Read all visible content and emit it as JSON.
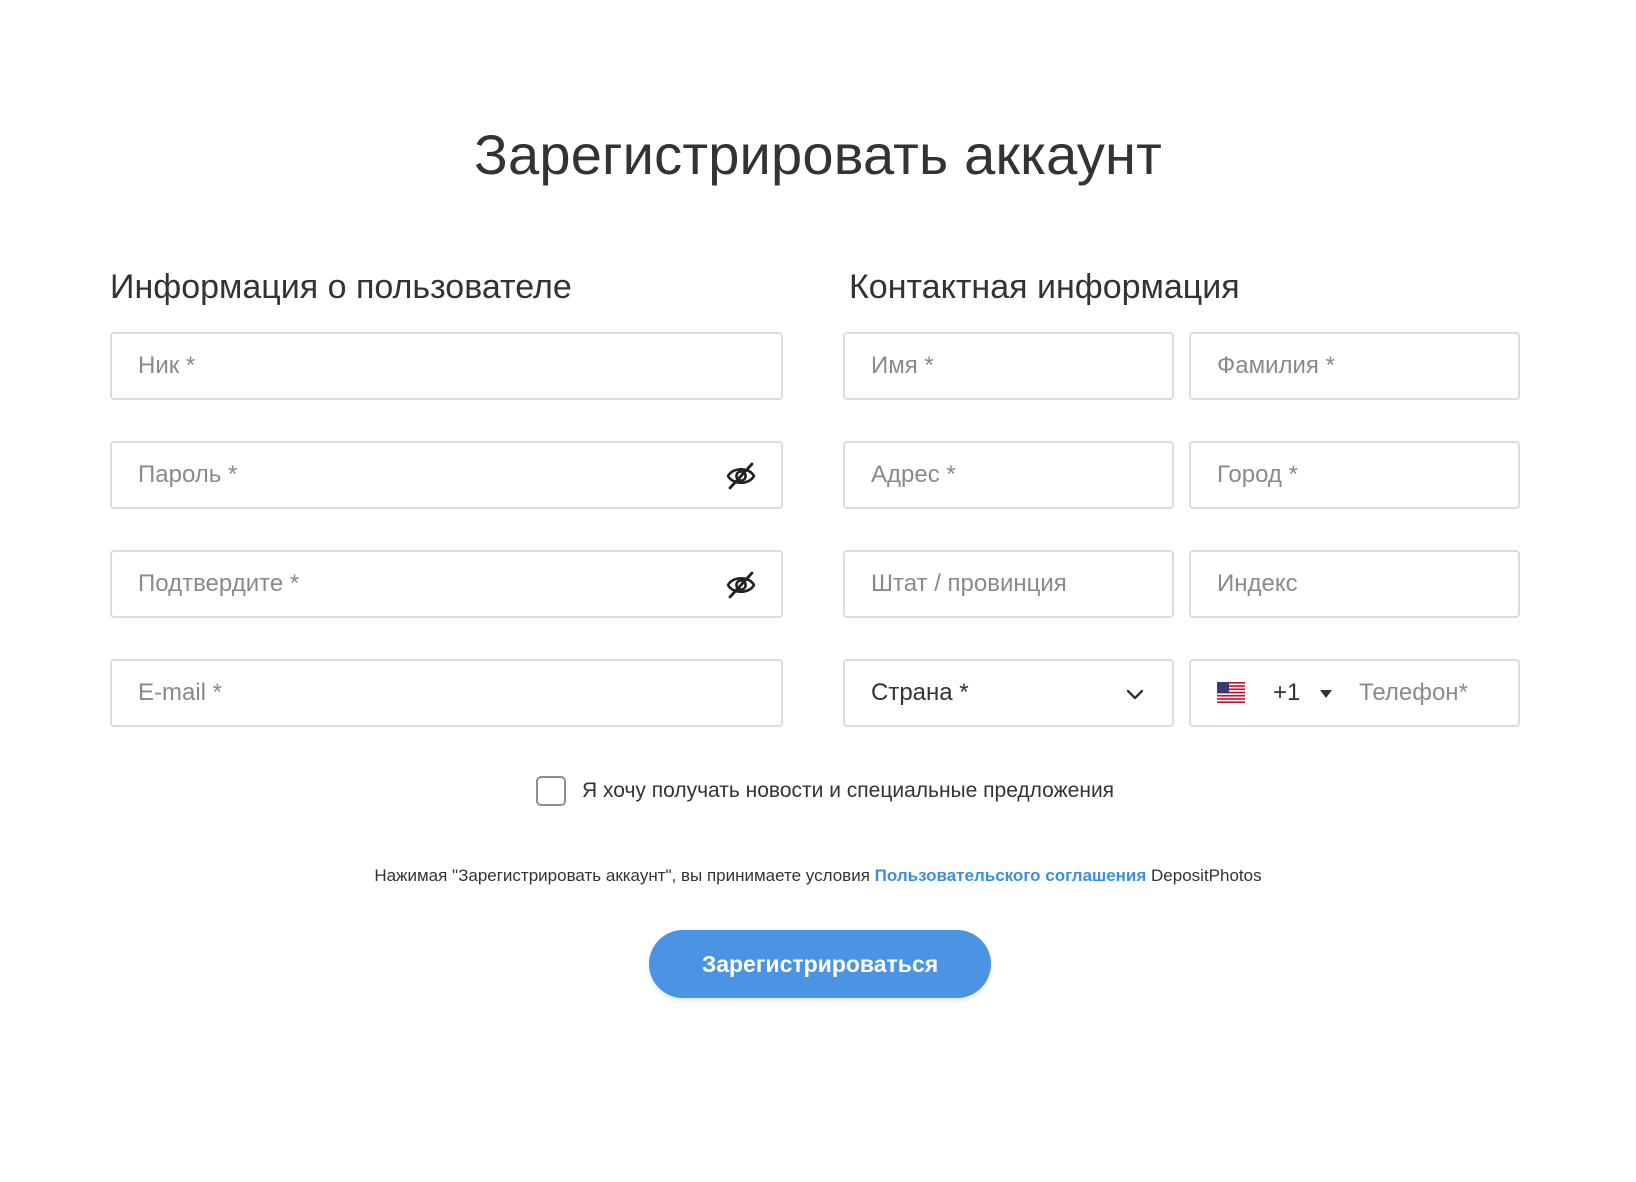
{
  "page": {
    "title": "Зарегистрировать аккаунт"
  },
  "user_section": {
    "title": "Информация о пользователе",
    "nick_placeholder": "Ник *",
    "password_placeholder": "Пароль *",
    "confirm_placeholder": "Подтвердите *",
    "email_placeholder": "E-mail *",
    "password_toggle_icon": "eye-off-icon"
  },
  "contact_section": {
    "title": "Контактная информация",
    "first_name_placeholder": "Имя *",
    "last_name_placeholder": "Фамилия *",
    "address_placeholder": "Адрес *",
    "city_placeholder": "Город *",
    "state_placeholder": "Штат / провинция",
    "zip_placeholder": "Индекс",
    "country_value": "Страна *",
    "phone_code": "+1",
    "phone_flag_icon": "us-flag-icon",
    "phone_placeholder": "Телефон*"
  },
  "newsletter": {
    "label": "Я хочу получать новости и специальные предложения",
    "checked": false
  },
  "terms": {
    "prefix": "Нажимая \"Зарегистрировать аккаунт\", вы принимаете условия ",
    "link_text": "Пользовательского соглашения",
    "suffix": " DepositPhotos"
  },
  "submit": {
    "label": "Зарегистрироваться"
  },
  "colors": {
    "accent": "#4a94e3",
    "link": "#3a8ee6",
    "border": "#dcdcdc",
    "placeholder": "#8a8a8a",
    "text": "#333333"
  }
}
